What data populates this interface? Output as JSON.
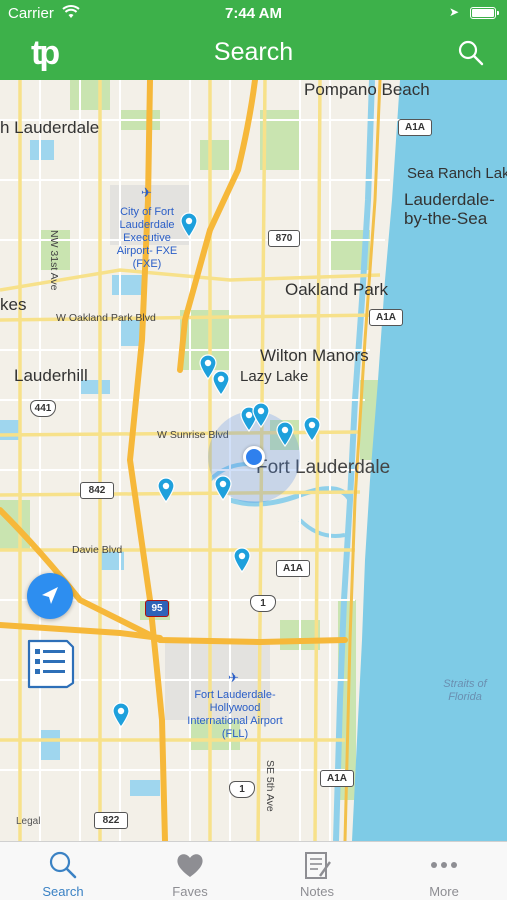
{
  "status_bar": {
    "carrier": "Carrier",
    "time": "7:44 AM"
  },
  "navbar": {
    "logo": "tp",
    "title": "Search"
  },
  "map": {
    "places": {
      "pompano_beach": "Pompano Beach",
      "lauderdale_left": "h Lauderdale",
      "sea_ranch": "Sea Ranch Lak",
      "lauderdale_by_the_sea_1": "Lauderdale-",
      "lauderdale_by_the_sea_2": "by-the-Sea",
      "oakland_park": "Oakland Park",
      "lakes": "kes",
      "wilton_manors": "Wilton Manors",
      "lazy_lake": "Lazy Lake",
      "lauderhill": "Lauderhill",
      "fort_lauderdale": "Fort Lauderdale"
    },
    "streets": {
      "nw_31st_ave": "NW 31st Ave",
      "w_oakland_park_blvd": "W Oakland Park Blvd",
      "w_sunrise_blvd": "W Sunrise Blvd",
      "davie_blvd": "Davie Blvd",
      "se_5th_ave": "SE 5th Ave"
    },
    "airports": {
      "fxe": "City of Fort Lauderdale Executive Airport- FXE (FXE)",
      "fll": "Fort Lauderdale-Hollywood International Airport (FLL)"
    },
    "water": {
      "straits": "Straits of Florida"
    },
    "shields": {
      "a1a_top": "A1A",
      "r870": "870",
      "a1a_mid": "A1A",
      "r441": "441",
      "r842": "842",
      "a1a_low": "A1A",
      "r1_upper": "1",
      "i95": "95",
      "r1_lower": "1",
      "a1a_bottom": "A1A",
      "r822": "822"
    },
    "legal": "Legal"
  },
  "tabs": [
    {
      "label": "Search",
      "icon": "search-icon",
      "active": true
    },
    {
      "label": "Faves",
      "icon": "heart-icon",
      "active": false
    },
    {
      "label": "Notes",
      "icon": "notes-icon",
      "active": false
    },
    {
      "label": "More",
      "icon": "more-icon",
      "active": false
    }
  ],
  "colors": {
    "brand_green": "#3db14a",
    "pin_blue": "#1ea0dc",
    "tab_active": "#3b82c4",
    "ocean": "#7ecbe6"
  }
}
